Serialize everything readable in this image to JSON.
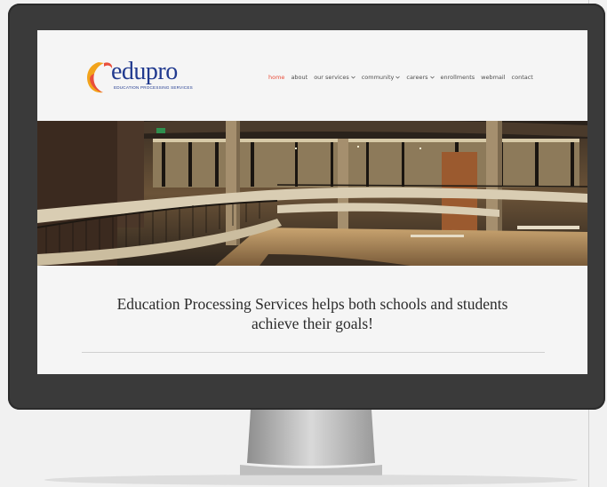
{
  "logo": {
    "word": "edupro",
    "tagline": "EDUCATION PROCESSING SERVICES"
  },
  "nav": [
    {
      "label": "home",
      "active": true
    },
    {
      "label": "about"
    },
    {
      "label": "our services",
      "dropdown": true
    },
    {
      "label": "community",
      "dropdown": true
    },
    {
      "label": "careers",
      "dropdown": true
    },
    {
      "label": "enrollments"
    },
    {
      "label": "webmail"
    },
    {
      "label": "contact"
    }
  ],
  "hero": {
    "tagline_line1": "Education Processing Services helps both schools and students",
    "tagline_line2": "achieve their goals!"
  },
  "colors": {
    "accent": "#e94e3b",
    "brand": "#213a8f",
    "bezel": "#3a3a3a"
  }
}
